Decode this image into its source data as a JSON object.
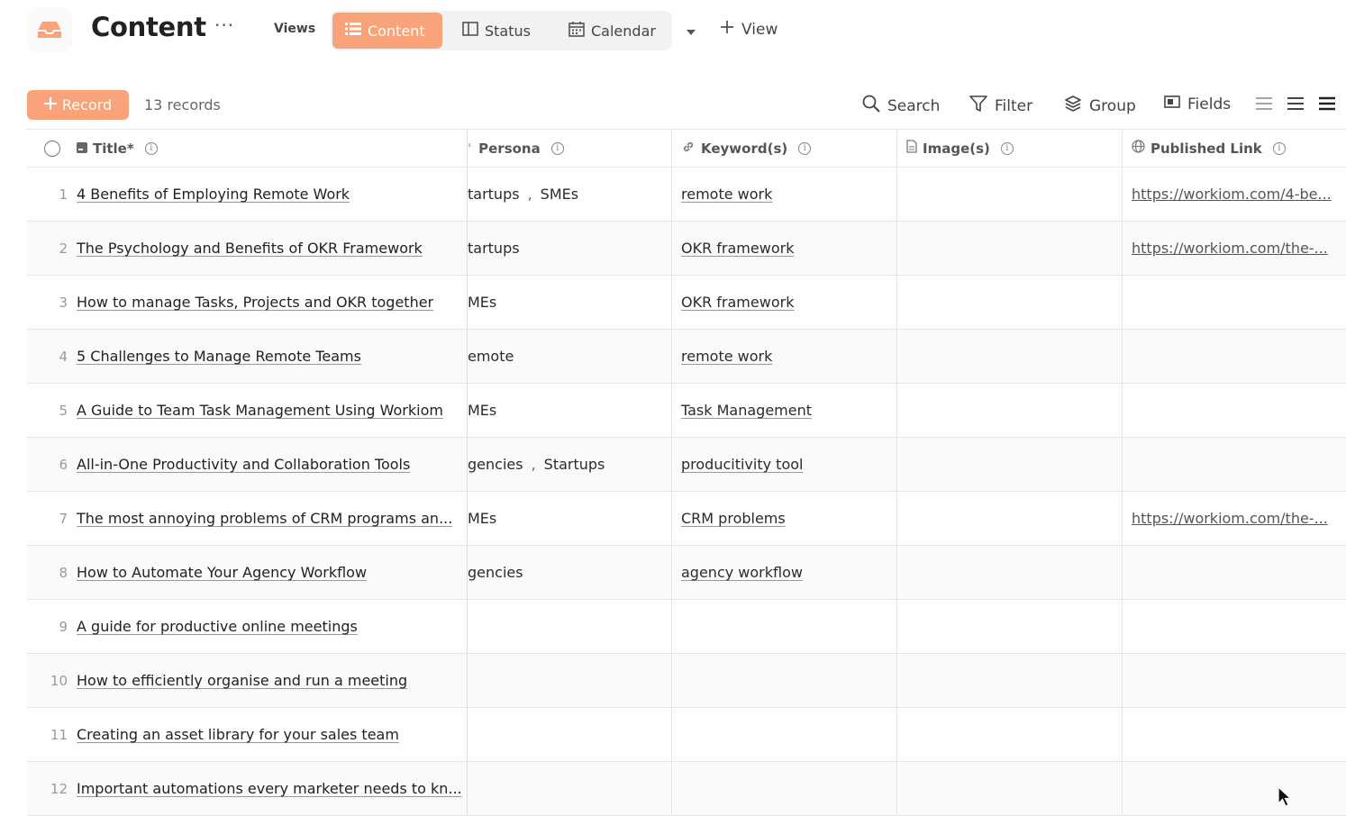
{
  "header": {
    "title": "Content",
    "more_label": "···",
    "views_label": "Views",
    "tabs": [
      {
        "label": "Content",
        "icon": "list-icon",
        "active": true
      },
      {
        "label": "Status",
        "icon": "kanban-icon",
        "active": false
      },
      {
        "label": "Calendar",
        "icon": "calendar-icon",
        "active": false
      }
    ],
    "add_view_label": "View"
  },
  "toolbar": {
    "record_label": "Record",
    "record_count": "13 records",
    "search_label": "Search",
    "filter_label": "Filter",
    "group_label": "Group",
    "fields_label": "Fields"
  },
  "colors": {
    "accent": "#f9a37a",
    "row_alt": "#f9fafc",
    "border": "#e6e6e6"
  },
  "table": {
    "columns": {
      "title": "Title*",
      "persona": "Persona",
      "keyword": "Keyword(s)",
      "image": "Image(s)",
      "link": "Published Link"
    },
    "rows": [
      {
        "num": "1",
        "title": "4 Benefits of Employing Remote Work",
        "persona": [
          "tartups",
          "SMEs"
        ],
        "keyword": "remote work",
        "link": "https://workiom.com/4-be..."
      },
      {
        "num": "2",
        "title": "The Psychology and Benefits of OKR Framework",
        "persona": [
          "tartups"
        ],
        "keyword": "OKR framework",
        "link": "https://workiom.com/the-..."
      },
      {
        "num": "3",
        "title": "How to manage Tasks, Projects and OKR together",
        "persona": [
          "MEs"
        ],
        "keyword": "OKR framework",
        "link": ""
      },
      {
        "num": "4",
        "title": "5 Challenges to Manage Remote Teams",
        "persona": [
          "emote"
        ],
        "keyword": "remote work",
        "link": ""
      },
      {
        "num": "5",
        "title": "A Guide to Team Task Management Using Workiom",
        "persona": [
          "MEs"
        ],
        "keyword": "Task Management",
        "link": ""
      },
      {
        "num": "6",
        "title": "All-in-One Productivity and Collaboration Tools",
        "persona": [
          "gencies",
          "Startups"
        ],
        "keyword": "producitivity tool",
        "link": ""
      },
      {
        "num": "7",
        "title": "The most annoying problems of CRM programs an...",
        "persona": [
          "MEs"
        ],
        "keyword": "CRM problems",
        "link": "https://workiom.com/the-..."
      },
      {
        "num": "8",
        "title": "How to Automate Your Agency Workflow",
        "persona": [
          "gencies"
        ],
        "keyword": "agency workflow",
        "link": ""
      },
      {
        "num": "9",
        "title": "A guide for productive online meetings",
        "persona": [],
        "keyword": "",
        "link": ""
      },
      {
        "num": "10",
        "title": "How to efficiently organise and run a meeting",
        "persona": [],
        "keyword": "",
        "link": ""
      },
      {
        "num": "11",
        "title": "Creating an asset library for your sales team",
        "persona": [],
        "keyword": "",
        "link": ""
      },
      {
        "num": "12",
        "title": "Important automations every marketer needs to kn...",
        "persona": [],
        "keyword": "",
        "link": ""
      }
    ]
  }
}
